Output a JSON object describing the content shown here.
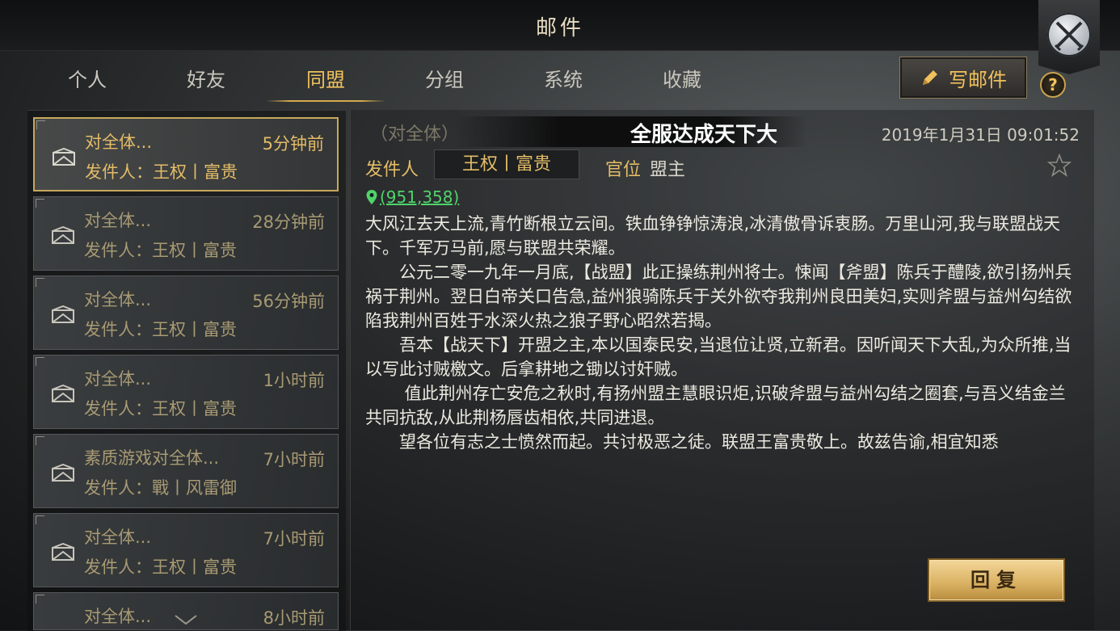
{
  "header": {
    "title": "邮件"
  },
  "tabs": [
    {
      "label": "个人"
    },
    {
      "label": "好友"
    },
    {
      "label": "同盟",
      "active": true
    },
    {
      "label": "分组"
    },
    {
      "label": "系统"
    },
    {
      "label": "收藏"
    }
  ],
  "toolbar": {
    "write_label": "写邮件",
    "help_label": "?"
  },
  "mail_list": [
    {
      "subject": "对全体...",
      "time": "5分钟前",
      "sender": "发件人：王权丨富贵",
      "selected": true
    },
    {
      "subject": "对全体...",
      "time": "28分钟前",
      "sender": "发件人：王权丨富贵"
    },
    {
      "subject": "对全体...",
      "time": "56分钟前",
      "sender": "发件人：王权丨富贵"
    },
    {
      "subject": "对全体...",
      "time": "1小时前",
      "sender": "发件人：王权丨富贵"
    },
    {
      "subject": "素质游戏对全体...",
      "time": "7小时前",
      "sender": "发件人：戰丨风雷御"
    },
    {
      "subject": "对全体...",
      "time": "7小时前",
      "sender": "发件人：王权丨富贵"
    },
    {
      "subject": "对全体...",
      "time": "8小时前",
      "sender": ""
    }
  ],
  "detail": {
    "recipient_tag": "（对全体）",
    "headline": "全服达成天下大",
    "date": "2019年1月31日 09:01:52",
    "sender_label": "发件人",
    "sender_name": "王权丨富贵",
    "rank_label": "官位",
    "rank_value": "盟主",
    "location": "(951,358)",
    "paragraphs": [
      "大风江去天上流,青竹断根立云间。铁血铮铮惊涛浪,冰清傲骨诉衷肠。万里山河,我与联盟战天下。千军万马前,愿与联盟共荣耀。",
      "　　公元二零一九年一月底,【战盟】此正操练荆州将士。悚闻【斧盟】陈兵于醴陵,欲引扬州兵祸于荆州。翌日白帝关口告急,益州狼骑陈兵于关外欲夺我荆州良田美妇,实则斧盟与益州勾结欲陷我荆州百姓于水深火热之狼子野心昭然若揭。",
      "　　吾本【战天下】开盟之主,本以国泰民安,当退位让贤,立新君。因听闻天下大乱,为众所推,当以写此讨贼檄文。后拿耕地之锄以讨奸贼。",
      "　　 值此荆州存亡安危之秋时,有扬州盟主慧眼识炬,识破斧盟与益州勾结之圈套,与吾义结金兰共同抗敌,从此荆杨唇齿相依,共同进退。",
      "　　望各位有志之士愤然而起。共讨极恶之徒。联盟王富贵敬上。故兹告谕,相宜知悉"
    ],
    "reply_label": "回复"
  },
  "colors": {
    "accent": "#e3bc67",
    "active_tab": "#f0c15c",
    "location": "#4fd46a"
  }
}
